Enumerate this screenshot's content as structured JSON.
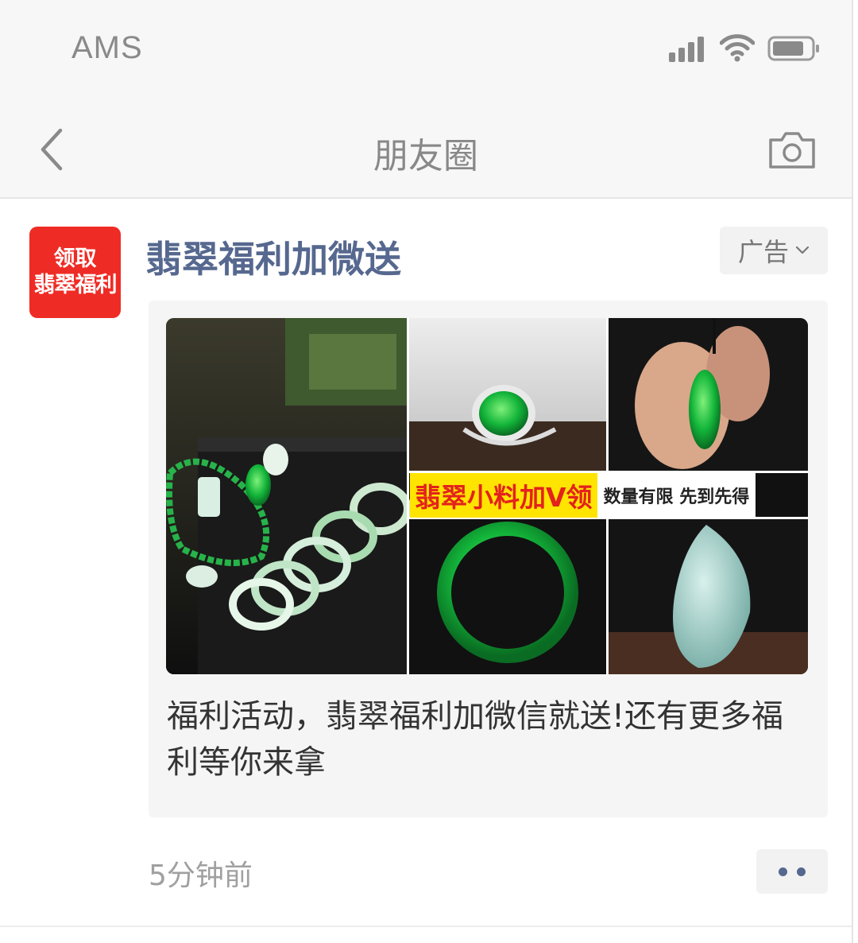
{
  "status_bar": {
    "carrier": "AMS",
    "icons": [
      "signal-icon",
      "wifi-icon",
      "battery-icon"
    ]
  },
  "nav": {
    "title": "朋友圈",
    "back_icon": "chevron-left-icon",
    "camera_icon": "camera-icon"
  },
  "post": {
    "avatar": {
      "line1": "领取",
      "line2": "翡翠福利"
    },
    "poster_name": "翡翠福利加微送",
    "ad_tag": "广告",
    "ad_image_overlay": {
      "highlight_text": "翡翠小料加V领",
      "side_text": "数量有限 先到先得"
    },
    "caption": "福利活动，翡翠福利加微信就送!还有更多福利等你来拿",
    "timestamp": "5分钟前"
  },
  "colors": {
    "accent_link": "#56688f",
    "avatar_bg": "#ef2b25",
    "bar_bg": "#f7f7f7"
  }
}
